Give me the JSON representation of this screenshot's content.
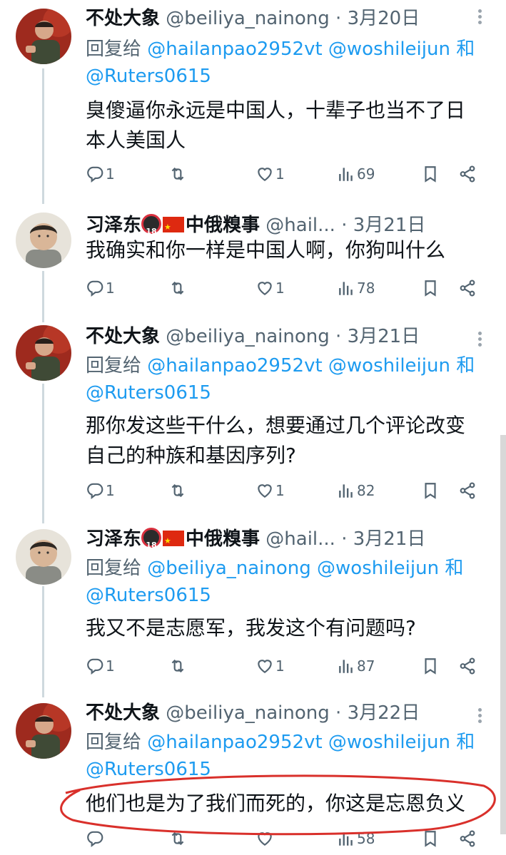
{
  "tweets": [
    {
      "author": "不处大象",
      "handle": "@beiliya_nainong",
      "sep": " · ",
      "date": "3月20日",
      "reply_prefix": "回复给",
      "reply_mentions_line1": "@hailanpao2952vt @woshileijun 和",
      "reply_mentions_line2": "@Ruters0615",
      "text": "臭傻逼你永远是中国人，十辈子也当不了日本人美国人",
      "replies": "1",
      "retweets": "",
      "likes": "1",
      "views": "69"
    },
    {
      "author": "习泽东",
      "author_suffix": "中俄糗事",
      "handle": "@hail...",
      "sep": " · ",
      "date": "3月21日",
      "text": "我确实和你一样是中国人啊，你狗叫什么",
      "replies": "1",
      "retweets": "",
      "likes": "1",
      "views": "78"
    },
    {
      "author": "不处大象",
      "handle": "@beiliya_nainong",
      "sep": " · ",
      "date": "3月21日",
      "reply_prefix": "回复给",
      "reply_mentions_line1": "@hailanpao2952vt @woshileijun 和",
      "reply_mentions_line2": "@Ruters0615",
      "text": "那你发这些干什么，想要通过几个评论改变自己的种族和基因序列?",
      "replies": "1",
      "retweets": "",
      "likes": "1",
      "views": "82"
    },
    {
      "author": "习泽东",
      "author_suffix": "中俄糗事",
      "handle": "@hail...",
      "sep": " · ",
      "date": "3月21日",
      "reply_prefix": "回复给",
      "reply_mentions_line1": "@beiliya_nainong @woshileijun 和",
      "reply_mentions_line2": "@Ruters0615",
      "text": "我又不是志愿军，我发这个有问题吗?",
      "replies": "1",
      "retweets": "",
      "likes": "1",
      "views": "87"
    },
    {
      "author": "不处大象",
      "handle": "@beiliya_nainong",
      "sep": " · ",
      "date": "3月22日",
      "reply_prefix": "回复给",
      "reply_mentions_line1": "@hailanpao2952vt @woshileijun 和",
      "reply_mentions_line2": "@Ruters0615",
      "text": "他们也是为了我们而死的，你这是忘恩负义",
      "replies": "",
      "retweets": "",
      "likes": "",
      "views": "58"
    }
  ],
  "icons": {
    "reply": "reply-icon",
    "retweet": "retweet-icon",
    "like": "heart-icon",
    "views": "views-icon",
    "bookmark": "bookmark-icon",
    "share": "share-icon",
    "more": "more-icon"
  },
  "colors": {
    "link": "#1d9bf0",
    "muted": "#536471",
    "annotation": "#d9302b"
  }
}
